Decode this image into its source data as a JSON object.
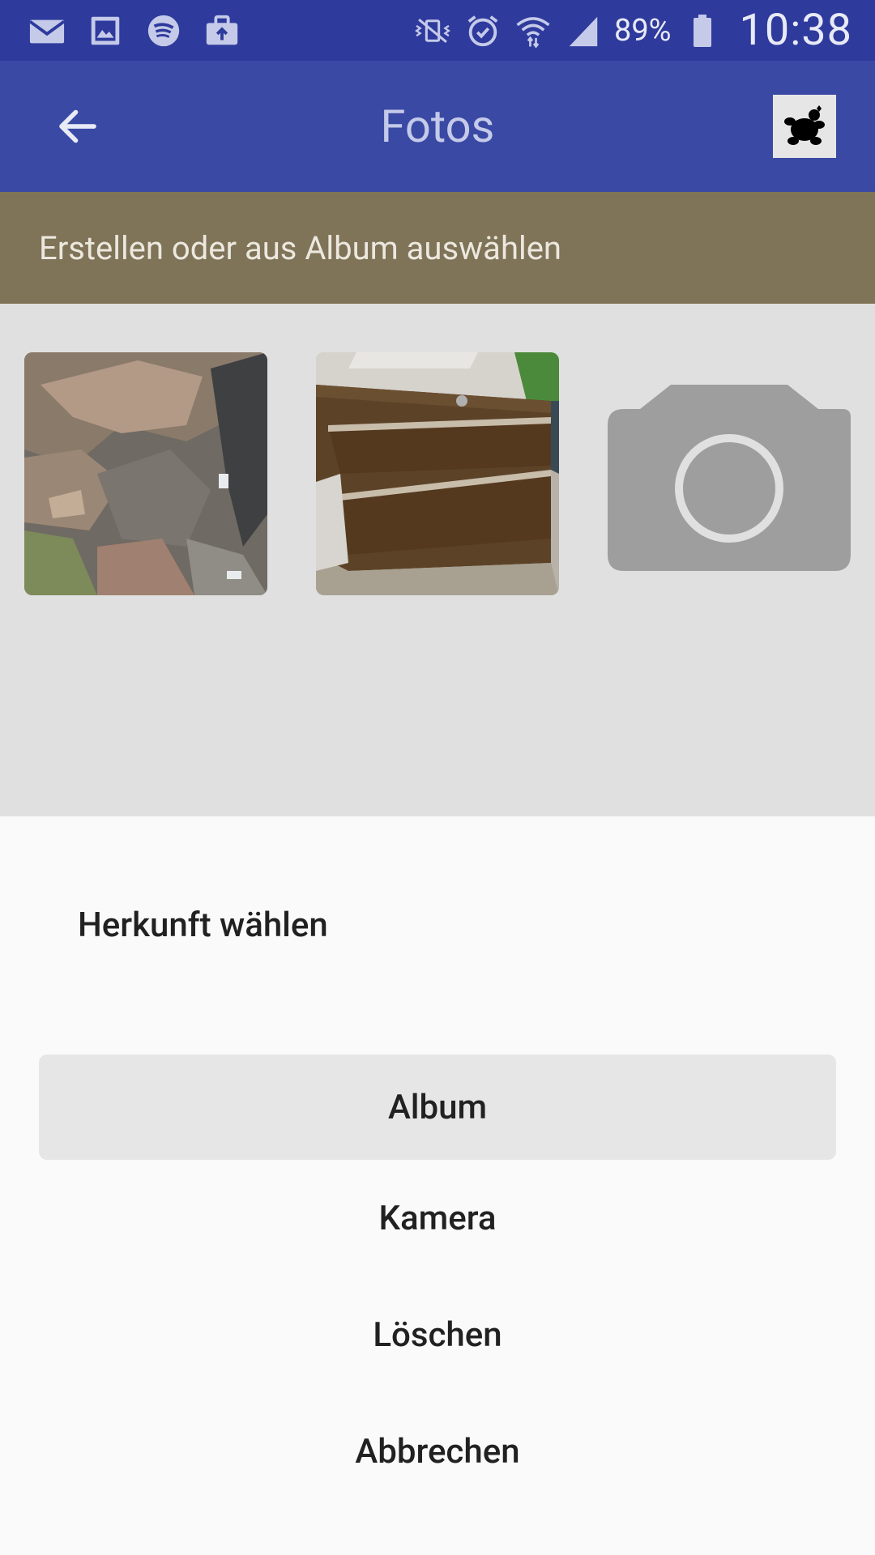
{
  "status_bar": {
    "left_icons": [
      "mail-icon",
      "image-icon",
      "spotify-icon",
      "briefcase-upload-icon"
    ],
    "right_icons": [
      "vibrate-icon",
      "alarm-icon",
      "wifi-icon",
      "signal-icon",
      "battery-icon"
    ],
    "battery_percent": "89%",
    "time": "10:38"
  },
  "app_bar": {
    "back_icon": "arrow-left-icon",
    "title": "Fotos",
    "logo_icon": "turtle-logo-icon"
  },
  "banner": {
    "text": "Erstellen oder aus Album auswählen"
  },
  "photos": [
    {
      "kind": "rock-photo"
    },
    {
      "kind": "cabinet-photo"
    },
    {
      "kind": "camera-placeholder-icon"
    }
  ],
  "sheet": {
    "title": "Herkunft wählen",
    "options": [
      "Album",
      "Kamera",
      "Löschen",
      "Abbrechen"
    ]
  },
  "colors": {
    "status_bar": "#2e3a9c",
    "app_bar": "#3949a4",
    "banner": "#7f7358",
    "grid_bg": "#e0e0e0",
    "sheet_bg": "#fafafa",
    "selected_option": "#e6e6e6"
  }
}
